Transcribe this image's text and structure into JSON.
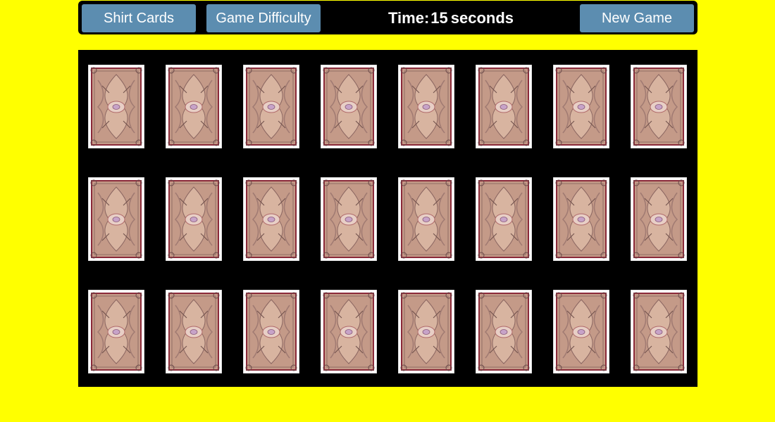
{
  "toolbar": {
    "shirt_cards_label": "Shirt Cards",
    "difficulty_label": "Game Difficulty",
    "new_game_label": "New Game",
    "timer_label": "Time:",
    "timer_value": "15",
    "timer_unit": "seconds"
  },
  "colors": {
    "background": "#ffff00",
    "panel": "#000000",
    "button": "#5c8db0",
    "card_back_border": "#ffffff",
    "card_back_frame": "#8b2a3a",
    "card_back_fill": "#c49a88"
  },
  "board": {
    "rows": 3,
    "columns": 8,
    "card_state": "face-down",
    "card_back_pattern": "ornate-card-back"
  }
}
